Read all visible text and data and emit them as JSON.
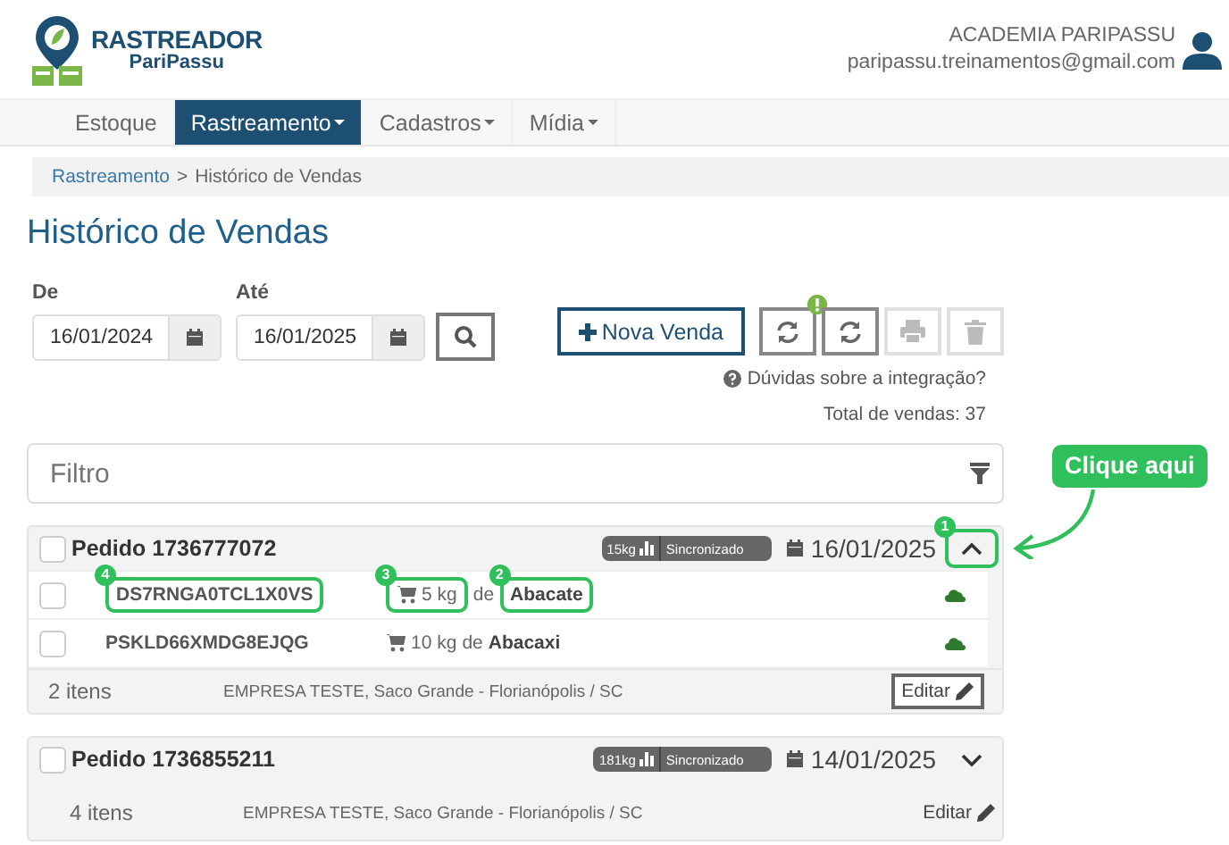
{
  "header": {
    "logo": {
      "title": "RASTREADOR",
      "subtitle": "PariPassu"
    },
    "user": {
      "name": "ACADEMIA PARIPASSU",
      "email": "paripassu.treinamentos@gmail.com"
    }
  },
  "nav": [
    {
      "label": "Estoque",
      "selected": false,
      "dropdown": false
    },
    {
      "label": "Rastreamento",
      "selected": true,
      "dropdown": true
    },
    {
      "label": "Cadastros",
      "selected": false,
      "dropdown": true
    },
    {
      "label": "Mídia",
      "selected": false,
      "dropdown": true
    }
  ],
  "breadcrumb": {
    "items": [
      "Rastreamento",
      "Histórico de Vendas"
    ],
    "separator": ">"
  },
  "page_title": "Histórico de Vendas",
  "date_filters": [
    {
      "label": "De",
      "value": "16/01/2024"
    },
    {
      "label": "Até",
      "value": "16/01/2025"
    }
  ],
  "actions": {
    "new_sale": "Nova Venda",
    "buttons": [
      {
        "kind": "sync",
        "alert": true,
        "disabled": false
      },
      {
        "kind": "sync",
        "disabled": false
      },
      {
        "kind": "print",
        "disabled": true
      },
      {
        "kind": "delete",
        "disabled": true
      }
    ],
    "help": "Dúvidas sobre a integração?",
    "total": "Total de vendas: 37"
  },
  "filter": {
    "placeholder": "Filtro"
  },
  "orders": [
    {
      "checked": false,
      "title": "Pedido 1736777072",
      "weight": "15kg",
      "status": "Sincronizado",
      "date": "16/01/2025",
      "expanded": true,
      "toggle_marker": "1",
      "items": [
        {
          "checked": false,
          "code": "DS7RNGA0TCL1X0VS",
          "code_marker": "4",
          "quantity": "5 kg",
          "quantity_marker": "3",
          "connector": "de",
          "product": "Abacate",
          "product_marker": "2"
        },
        {
          "checked": false,
          "code": "PSKLD66XMDG8EJQG",
          "quantity": "10 kg",
          "connector": "de",
          "product": "Abacaxi"
        }
      ],
      "count": "2 itens",
      "company": "EMPRESA TESTE, Saco Grande - Florianópolis / SC",
      "edit": "Editar"
    },
    {
      "checked": false,
      "title": "Pedido 1736855211",
      "weight": "181kg",
      "status": "Sincronizado",
      "date": "14/01/2025",
      "expanded": false,
      "count": "4 itens",
      "company": "EMPRESA TESTE, Saco Grande - Florianópolis / SC",
      "edit": "Editar"
    }
  ],
  "annotations": {
    "callout": "Clique aqui"
  }
}
